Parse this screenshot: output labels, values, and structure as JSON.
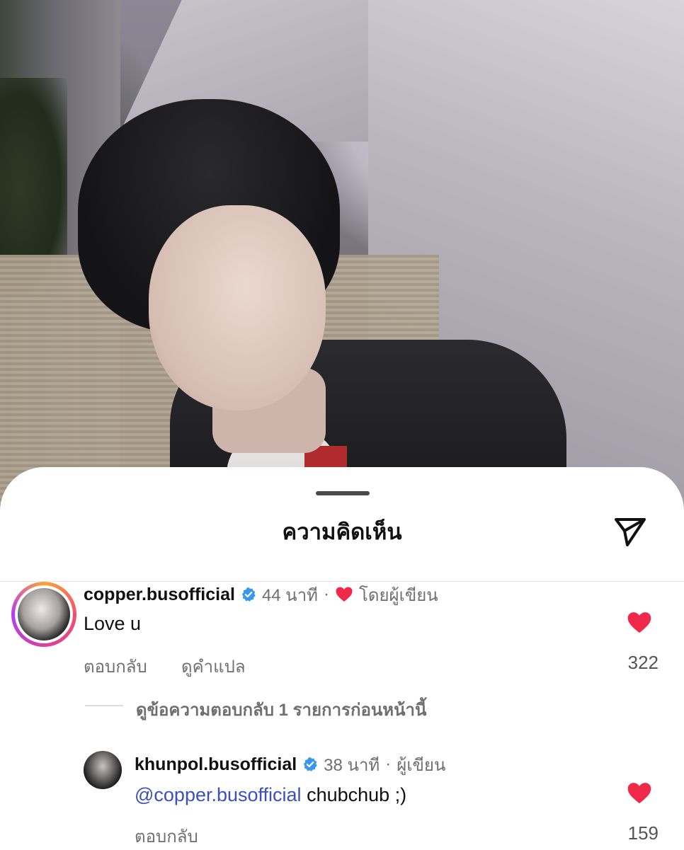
{
  "sheet": {
    "title": "ความคิดเห็น",
    "share_icon": "send-icon"
  },
  "comments": [
    {
      "username": "copper.busofficial",
      "verified": true,
      "time": "44 นาที",
      "separator": "·",
      "liked_by_author_label": "โดยผู้เขียน",
      "text": "Love u",
      "reply_label": "ตอบกลับ",
      "translate_label": "ดูคำแปล",
      "likes": "322",
      "liked": true,
      "view_replies_label": "ดูข้อความตอบกลับ 1 รายการก่อนหน้านี้"
    },
    {
      "username": "khunpol.busofficial",
      "verified": true,
      "time": "38 นาที",
      "separator": "·",
      "author_label": "ผู้เขียน",
      "mention": "@copper.busofficial",
      "text": "chubchub ;)",
      "reply_label": "ตอบกลับ",
      "likes": "159",
      "liked": true
    }
  ],
  "colors": {
    "heart": "#f02849",
    "verified": "#3897f0",
    "mention": "#3b4fbf"
  }
}
